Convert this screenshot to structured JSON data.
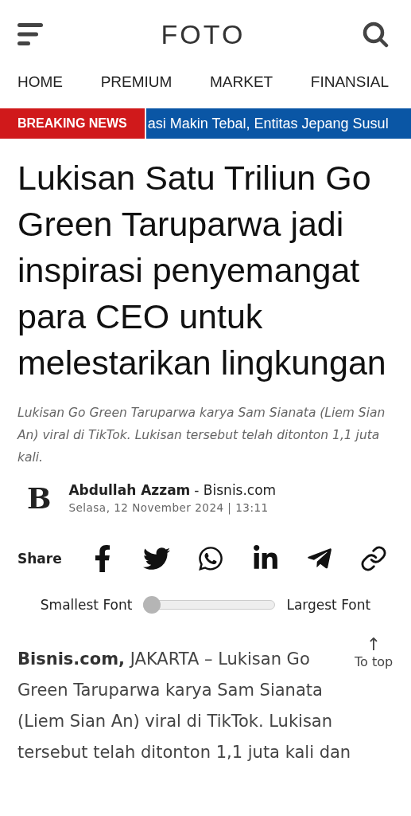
{
  "header": {
    "title": "FOTO"
  },
  "nav": [
    {
      "label": "HOME"
    },
    {
      "label": "PREMIUM"
    },
    {
      "label": "MARKET"
    },
    {
      "label": "FINANSIAL"
    }
  ],
  "breaking": {
    "label": "BREAKING NEWS",
    "ticker": "asi Makin Tebal, Entitas Jepang Susul"
  },
  "article": {
    "title": "Lukisan Satu Triliun Go Green Taruparwa jadi inspirasi penyemangat para CEO untuk melestarikan lingkungan",
    "summary": "Lukisan Go Green Taruparwa karya Sam Sianata (Liem Sian An) viral di TikTok. Lukisan tersebut telah ditonton 1,1 juta kali.",
    "author": {
      "logo_letter": "B",
      "name": "Abdullah Azzam",
      "source": "- Bisnis.com",
      "date": "Selasa, 12 November 2024 | 13:11"
    },
    "share": {
      "label": "Share",
      "buttons": [
        {
          "kind": "facebook"
        },
        {
          "kind": "twitter"
        },
        {
          "kind": "whatsapp"
        },
        {
          "kind": "linkedin"
        },
        {
          "kind": "telegram"
        },
        {
          "kind": "link"
        }
      ]
    },
    "font_size": {
      "min_label": "Smallest Font",
      "max_label": "Largest Font",
      "level": 0
    },
    "body": "**Bisnis.com,** JAKARTA – Lukisan Go Green Taruparwa karya Sam Sianata (Liem Sian An) viral di TikTok. Lukisan tersebut telah ditonton 1,1 juta kali dan",
    "to_top": {
      "arrow": "↑",
      "label": "To top"
    }
  }
}
